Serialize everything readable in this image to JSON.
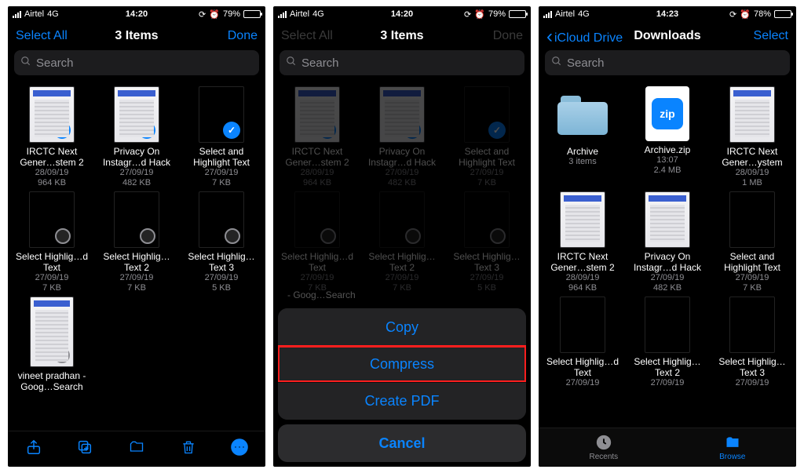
{
  "screens": [
    {
      "status": {
        "carrier": "Airtel",
        "net": "4G",
        "time": "14:20",
        "alarm": "⏰",
        "batt_pct": "79%"
      },
      "header": {
        "left": "Select All",
        "title": "3 Items",
        "right": "Done"
      },
      "search_placeholder": "Search",
      "files": [
        {
          "name": "IRCTC Next Gener…stem 2",
          "date": "28/09/19",
          "size": "964 KB",
          "thumb": "doc",
          "selected": true
        },
        {
          "name": "Privacy On Instagr…d Hack",
          "date": "27/09/19",
          "size": "482 KB",
          "thumb": "doc",
          "selected": true
        },
        {
          "name": "Select and Highlight Text",
          "date": "27/09/19",
          "size": "7 KB",
          "thumb": "dark",
          "selected": true
        },
        {
          "name": "Select Highlig…d Text",
          "date": "27/09/19",
          "size": "7 KB",
          "thumb": "dark",
          "selected": false
        },
        {
          "name": "Select Highlig…Text 2",
          "date": "27/09/19",
          "size": "7 KB",
          "thumb": "dark",
          "selected": false
        },
        {
          "name": "Select Highlig…Text 3",
          "date": "27/09/19",
          "size": "5 KB",
          "thumb": "dark",
          "selected": false
        },
        {
          "name": "vineet pradhan - Goog…Search",
          "date": "",
          "size": "",
          "thumb": "doc",
          "selected": false,
          "tall": true
        }
      ],
      "toolbar_icons": [
        "share",
        "duplicate",
        "move",
        "trash",
        "more"
      ]
    },
    {
      "status": {
        "carrier": "Airtel",
        "net": "4G",
        "time": "14:20",
        "alarm": "⏰",
        "batt_pct": "79%"
      },
      "header": {
        "left": "Select All",
        "title": "3 Items",
        "right": "Done",
        "dim": true
      },
      "search_placeholder": "Search",
      "files": [
        {
          "name": "IRCTC Next Gener…stem 2",
          "date": "28/09/19",
          "size": "964 KB",
          "thumb": "doc",
          "selected": true
        },
        {
          "name": "Privacy On Instagr…d Hack",
          "date": "27/09/19",
          "size": "482 KB",
          "thumb": "doc",
          "selected": true
        },
        {
          "name": "Select and Highlight Text",
          "date": "27/09/19",
          "size": "7 KB",
          "thumb": "dark",
          "selected": true
        },
        {
          "name": "Select Highlig…d Text",
          "date": "27/09/19",
          "size": "7 KB",
          "thumb": "dark",
          "selected": false
        },
        {
          "name": "Select Highlig…Text 2",
          "date": "27/09/19",
          "size": "7 KB",
          "thumb": "dark",
          "selected": false
        },
        {
          "name": "Select Highlig…Text 3",
          "date": "27/09/19",
          "size": "5 KB",
          "thumb": "dark",
          "selected": false
        }
      ],
      "action_sheet": {
        "items": [
          "Copy",
          "Compress",
          "Create PDF"
        ],
        "highlight_index": 1,
        "cancel": "Cancel"
      },
      "partial_text": "- Goog…Search"
    },
    {
      "status": {
        "carrier": "Airtel",
        "net": "4G",
        "time": "14:23",
        "alarm": "⏰",
        "batt_pct": "78%"
      },
      "header": {
        "left": "iCloud Drive",
        "left_chev": true,
        "title": "Downloads",
        "right": "Select"
      },
      "search_placeholder": "Search",
      "files": [
        {
          "name": "Archive",
          "date": "3 items",
          "size": "",
          "thumb": "folder"
        },
        {
          "name": "Archive.zip",
          "date": "13:07",
          "size": "2.4 MB",
          "thumb": "zip"
        },
        {
          "name": "IRCTC Next Gener…ystem",
          "date": "28/09/19",
          "size": "1 MB",
          "thumb": "doc"
        },
        {
          "name": "IRCTC Next Gener…stem 2",
          "date": "28/09/19",
          "size": "964 KB",
          "thumb": "doc"
        },
        {
          "name": "Privacy On Instagr…d Hack",
          "date": "27/09/19",
          "size": "482 KB",
          "thumb": "doc"
        },
        {
          "name": "Select and Highlight Text",
          "date": "27/09/19",
          "size": "7 KB",
          "thumb": "dark"
        },
        {
          "name": "Select Highlig…d Text",
          "date": "27/09/19",
          "size": "",
          "thumb": "dark",
          "cut": true
        },
        {
          "name": "Select Highlig…Text 2",
          "date": "27/09/19",
          "size": "",
          "thumb": "dark",
          "cut": true
        },
        {
          "name": "Select Highlig…Text 3",
          "date": "27/09/19",
          "size": "",
          "thumb": "dark",
          "cut": true
        }
      ],
      "tabbar": {
        "recents": "Recents",
        "browse": "Browse",
        "active": "browse"
      }
    }
  ]
}
